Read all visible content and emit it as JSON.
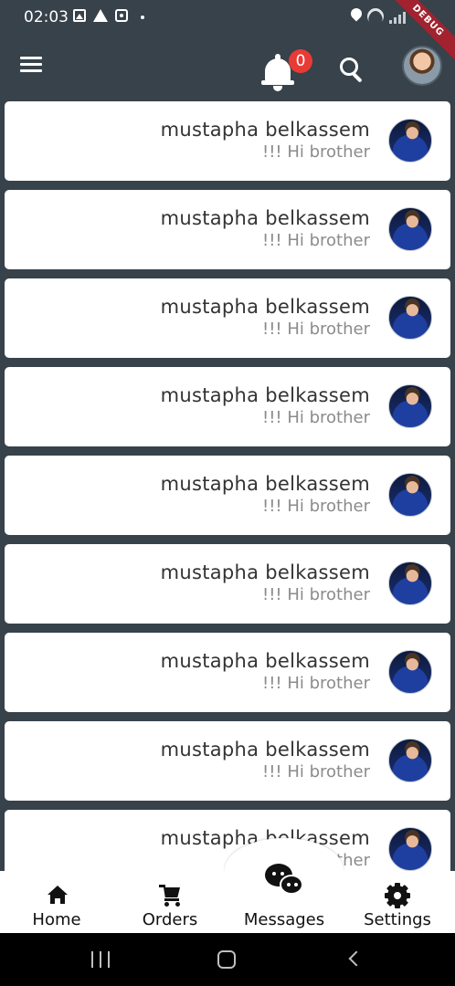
{
  "status_bar": {
    "time": "02:03",
    "debug_label": "DEBUG"
  },
  "app_bar": {
    "notification_count": "0"
  },
  "chats": [
    {
      "name": "mustapha belkassem",
      "message": "!!! Hi brother"
    },
    {
      "name": "mustapha belkassem",
      "message": "!!! Hi brother"
    },
    {
      "name": "mustapha belkassem",
      "message": "!!! Hi brother"
    },
    {
      "name": "mustapha belkassem",
      "message": "!!! Hi brother"
    },
    {
      "name": "mustapha belkassem",
      "message": "!!! Hi brother"
    },
    {
      "name": "mustapha belkassem",
      "message": "!!! Hi brother"
    },
    {
      "name": "mustapha belkassem",
      "message": "!!! Hi brother"
    },
    {
      "name": "mustapha belkassem",
      "message": "!!! Hi brother"
    },
    {
      "name": "mustapha belkassem",
      "message": "!!! Hi brother"
    }
  ],
  "bottom_nav": {
    "home": "Home",
    "orders": "Orders",
    "messages": "Messages",
    "settings": "Settings"
  },
  "colors": {
    "app_bar_bg": "#37424b",
    "badge": "#e83b36",
    "debug_ribbon": "#a2222f"
  }
}
